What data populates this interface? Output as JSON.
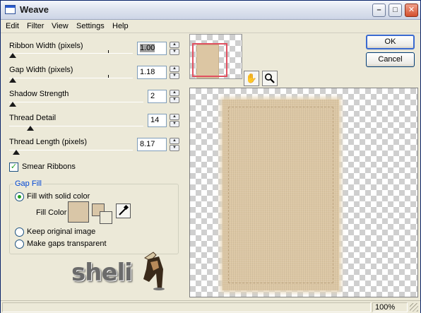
{
  "window": {
    "title": "Weave",
    "controls": {
      "minimize": "–",
      "maximize": "□",
      "close": "✕"
    }
  },
  "menu": [
    "Edit",
    "Filter",
    "View",
    "Settings",
    "Help"
  ],
  "params": {
    "ribbon_width": {
      "label": "Ribbon Width (pixels)",
      "value": "1.00"
    },
    "gap_width": {
      "label": "Gap Width (pixels)",
      "value": "1.18"
    },
    "shadow_strength": {
      "label": "Shadow Strength",
      "value": "2"
    },
    "thread_detail": {
      "label": "Thread Detail",
      "value": "14"
    },
    "thread_length": {
      "label": "Thread Length (pixels)",
      "value": "8.17"
    }
  },
  "smear_ribbons": {
    "label": "Smear Ribbons",
    "checked": true
  },
  "gap_fill": {
    "title": "Gap Fill",
    "options": [
      {
        "label": "Fill with solid color",
        "selected": true
      },
      {
        "label": "Keep original image",
        "selected": false
      },
      {
        "label": "Make gaps transparent",
        "selected": false
      }
    ],
    "fill_color_label": "Fill Color",
    "fill_color": "#d9c6a7"
  },
  "logo": {
    "text": "sheli"
  },
  "buttons": {
    "ok": "OK",
    "cancel": "Cancel"
  },
  "tools": {
    "hand": "✋",
    "zoom": "🔍"
  },
  "status": {
    "zoom": "100%"
  },
  "colors": {
    "accent": "#0046d5",
    "swatch": "#d9c6a7",
    "preview_red": "#e05060"
  }
}
